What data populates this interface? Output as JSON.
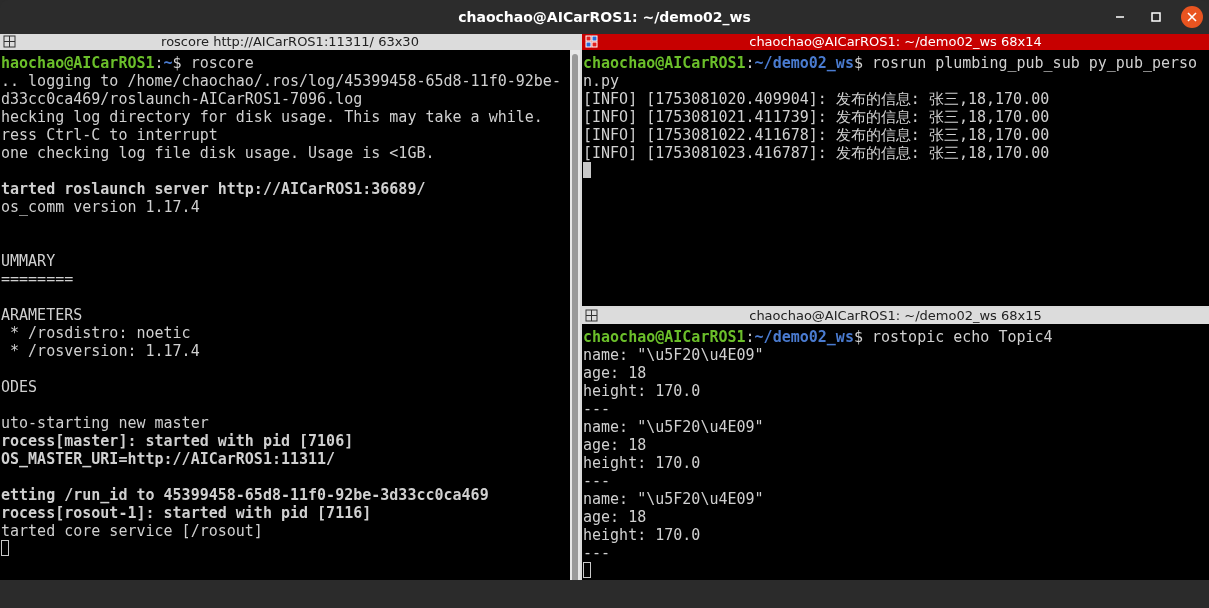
{
  "window": {
    "title": "chaochao@AICarROS1: ~/demo02_ws"
  },
  "terminals": [
    {
      "title": "roscore http://AICarROS1:11311/ 63x30",
      "active": false,
      "scrollbar": true,
      "cursor": {
        "filled": false
      },
      "lines": [
        {
          "kind": "prompt",
          "user": "haochao@AICarROS1",
          "separator": ":",
          "path": "~",
          "command": "$ roscore"
        },
        {
          "kind": "output",
          "text": ".. logging to /home/chaochao/.ros/log/45399458-65d8-11f0-92be-",
          "bold": false
        },
        {
          "kind": "output",
          "text": "d33cc0ca469/roslaunch-AICarROS1-7096.log",
          "bold": false
        },
        {
          "kind": "output",
          "text": "hecking log directory for disk usage. This may take a while.",
          "bold": false
        },
        {
          "kind": "output",
          "text": "ress Ctrl-C to interrupt",
          "bold": false
        },
        {
          "kind": "output",
          "text": "one checking log file disk usage. Usage is <1GB.",
          "bold": false
        },
        {
          "kind": "blank"
        },
        {
          "kind": "output",
          "text": "tarted roslaunch server http://AICarROS1:36689/",
          "bold": true
        },
        {
          "kind": "output",
          "text": "os_comm version 1.17.4",
          "bold": false
        },
        {
          "kind": "blank"
        },
        {
          "kind": "blank"
        },
        {
          "kind": "output",
          "text": "UMMARY",
          "bold": false
        },
        {
          "kind": "output",
          "text": "========",
          "bold": false
        },
        {
          "kind": "blank"
        },
        {
          "kind": "output",
          "text": "ARAMETERS",
          "bold": false
        },
        {
          "kind": "output",
          "text": " * /rosdistro: noetic",
          "bold": false
        },
        {
          "kind": "output",
          "text": " * /rosversion: 1.17.4",
          "bold": false
        },
        {
          "kind": "blank"
        },
        {
          "kind": "output",
          "text": "ODES",
          "bold": false
        },
        {
          "kind": "blank"
        },
        {
          "kind": "output",
          "text": "uto-starting new master",
          "bold": false
        },
        {
          "kind": "output",
          "text": "rocess[master]: started with pid [7106]",
          "bold": true
        },
        {
          "kind": "output",
          "text": "OS_MASTER_URI=http://AICarROS1:11311/",
          "bold": true
        },
        {
          "kind": "blank"
        },
        {
          "kind": "output",
          "text": "etting /run_id to 45399458-65d8-11f0-92be-3d33cc0ca469",
          "bold": true
        },
        {
          "kind": "output",
          "text": "rocess[rosout-1]: started with pid [7116]",
          "bold": true
        },
        {
          "kind": "output",
          "text": "tarted core service [/rosout]",
          "bold": false
        }
      ]
    },
    {
      "title": "chaochao@AICarROS1: ~/demo02_ws 68x14",
      "active": true,
      "scrollbar": false,
      "cursor": {
        "filled": true
      },
      "lines": [
        {
          "kind": "prompt",
          "user": "chaochao@AICarROS1",
          "separator": ":",
          "path": "~/demo02_ws",
          "command": "$ rosrun plumbing_pub_sub py_pub_perso"
        },
        {
          "kind": "output",
          "text": "n.py",
          "bold": false
        },
        {
          "kind": "output",
          "text": "[INFO] [1753081020.409904]: 发布的信息: 张三,18,170.00",
          "bold": false
        },
        {
          "kind": "output",
          "text": "[INFO] [1753081021.411739]: 发布的信息: 张三,18,170.00",
          "bold": false
        },
        {
          "kind": "output",
          "text": "[INFO] [1753081022.411678]: 发布的信息: 张三,18,170.00",
          "bold": false
        },
        {
          "kind": "output",
          "text": "[INFO] [1753081023.416787]: 发布的信息: 张三,18,170.00",
          "bold": false
        }
      ]
    },
    {
      "title": "chaochao@AICarROS1: ~/demo02_ws 68x15",
      "active": false,
      "scrollbar": false,
      "cursor": {
        "filled": false
      },
      "lines": [
        {
          "kind": "prompt",
          "user": "chaochao@AICarROS1",
          "separator": ":",
          "path": "~/demo02_ws",
          "command": "$ rostopic echo Topic4"
        },
        {
          "kind": "output",
          "text": "name: \"\\u5F20\\u4E09\"",
          "bold": false
        },
        {
          "kind": "output",
          "text": "age: 18",
          "bold": false
        },
        {
          "kind": "output",
          "text": "height: 170.0",
          "bold": false
        },
        {
          "kind": "output",
          "text": "---",
          "bold": false
        },
        {
          "kind": "output",
          "text": "name: \"\\u5F20\\u4E09\"",
          "bold": false
        },
        {
          "kind": "output",
          "text": "age: 18",
          "bold": false
        },
        {
          "kind": "output",
          "text": "height: 170.0",
          "bold": false
        },
        {
          "kind": "output",
          "text": "---",
          "bold": false
        },
        {
          "kind": "output",
          "text": "name: \"\\u5F20\\u4E09\"",
          "bold": false
        },
        {
          "kind": "output",
          "text": "age: 18",
          "bold": false
        },
        {
          "kind": "output",
          "text": "height: 170.0",
          "bold": false
        },
        {
          "kind": "output",
          "text": "---",
          "bold": false
        }
      ]
    }
  ]
}
